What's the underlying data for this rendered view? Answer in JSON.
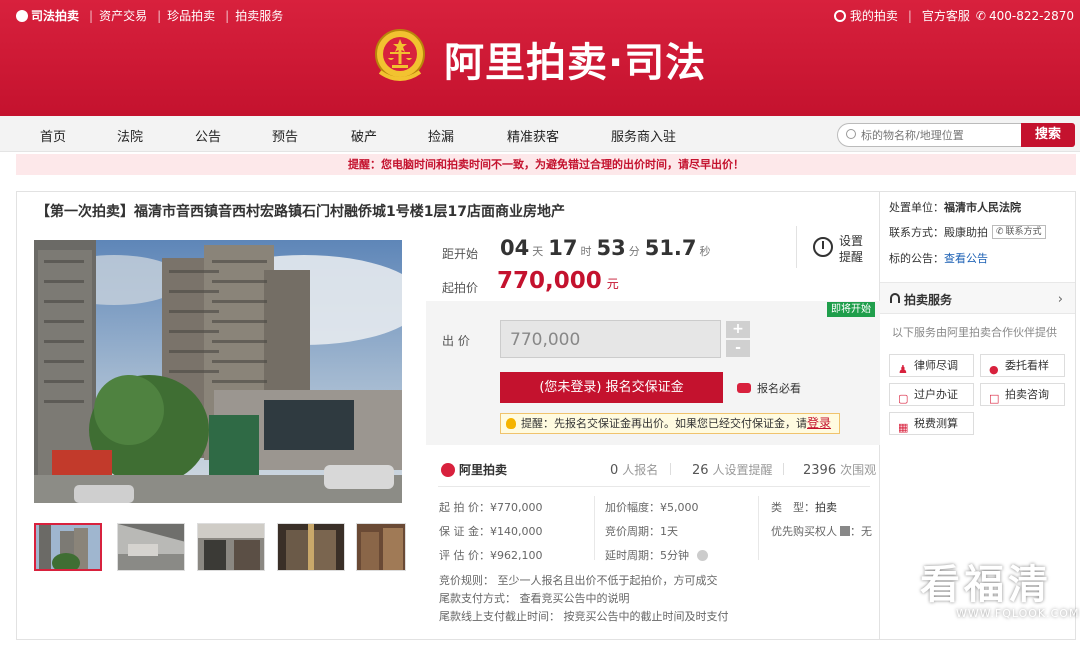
{
  "topbar": {
    "brand": "司法拍卖",
    "links": [
      "资产交易",
      "珍品拍卖",
      "拍卖服务"
    ],
    "my_auction": "我的拍卖",
    "service": "官方客服",
    "phone": "400-822-2870"
  },
  "header": {
    "title": "阿里拍卖·司法"
  },
  "nav": {
    "items": [
      "首页",
      "法院",
      "公告",
      "预告",
      "破产",
      "捡漏",
      "精准获客",
      "服务商入驻"
    ],
    "search_placeholder": "标的物名称/地理位置",
    "search_button": "搜索"
  },
  "notice": "提醒：您电脑时间和拍卖时间不一致，为避免错过合理的出价时间，请尽早出价！",
  "lot": {
    "title": "【第一次拍卖】福清市音西镇音西村宏路镇石门村融侨城1号楼1层17店面商业房地产",
    "countdown_label": "距开始",
    "days": "04",
    "days_unit": "天",
    "hours": "17",
    "hours_unit": "时",
    "minutes": "53",
    "minutes_unit": "分",
    "seconds": "51.7",
    "seconds_unit": "秒",
    "remind_label_1": "设置",
    "remind_label_2": "提醒",
    "start_price_label": "起拍价",
    "start_price": "770,000",
    "start_price_unit": "元",
    "soon_badge": "即将开始",
    "bid_label": "出 价",
    "bid_value": "770,000",
    "plus": "+",
    "minus": "-",
    "register_button": "(您未登录) 报名交保证金",
    "must_read": "报名必看",
    "tip_text": "提醒：先报名交保证金再出价。如果您已经交付保证金，请",
    "tip_login": "登录"
  },
  "stats": {
    "brand": "阿里拍卖",
    "signups": "0",
    "signups_label": "人报名",
    "reminders": "26",
    "reminders_label": "人设置提醒",
    "views": "2396",
    "views_label": "次围观"
  },
  "details": {
    "start_price": "起 拍 价：¥770,000",
    "deposit": "保 证 金：¥140,000",
    "appraisal": "评 估 价：¥962,100",
    "increment": "加价幅度：¥5,000",
    "bid_cycle": "竞价周期：1天",
    "delay_cycle": "延时周期：5分钟",
    "type_label": "类　型：",
    "type_value": "拍卖",
    "priority_label": "优先购买权人",
    "priority_value": "：无",
    "rule": "竞价规则：  至少一人报名且出价不低于起拍价，方可成交",
    "payment": "尾款支付方式：  查看竞买公告中的说明",
    "deadline": "尾款线上支付截止时间：  按竞买公告中的截止时间及时支付"
  },
  "side": {
    "court_label": "处置单位：",
    "court_value": "福清市人民法院",
    "contact_label": "联系方式：",
    "contact_value": "殿康助拍",
    "contact_button": "联系方式",
    "notice_label": "标的公告：",
    "notice_value": "查看公告",
    "services_title": "拍卖服务",
    "services_desc": "以下服务由阿里拍卖合作伙伴提供",
    "services": [
      "律师尽调",
      "委托看样",
      "过户办证",
      "拍卖咨询",
      "税费测算"
    ]
  },
  "watermark": {
    "main": "看福清",
    "sub": "WWW.FQLOOK.COM"
  },
  "colors": {
    "brand_red": "#c4122e",
    "price_red": "#c4122e",
    "green": "#1f9e4b"
  }
}
